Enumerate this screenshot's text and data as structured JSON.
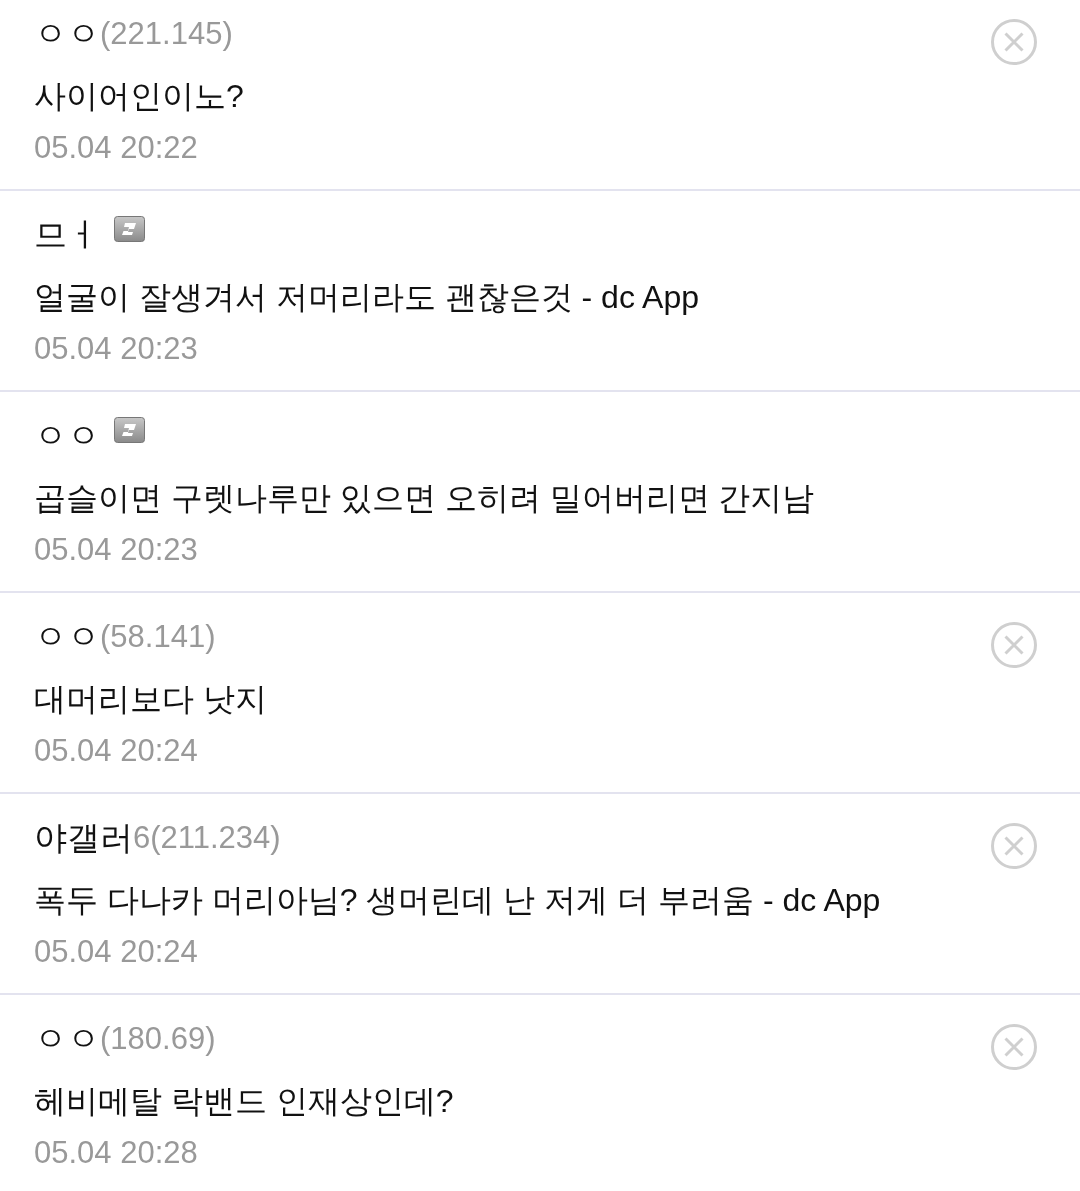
{
  "comments": [
    {
      "kind": "guest",
      "nickname": "ㅇㅇ",
      "ip": "(221.145)",
      "text": "사이어인이노?",
      "date": "05.04 20:22"
    },
    {
      "kind": "member",
      "nickname": "므ㅓ",
      "text": "얼굴이 잘생겨서 저머리라도 괜찮은것 - dc App",
      "date": "05.04 20:23"
    },
    {
      "kind": "member",
      "nickname": "ㅇㅇ",
      "text": "곱슬이면 구렛나루만 있으면 오히려 밀어버리면 간지남",
      "date": "05.04 20:23"
    },
    {
      "kind": "guest",
      "nickname": "ㅇㅇ",
      "ip": "(58.141)",
      "text": "대머리보다 낫지",
      "date": "05.04 20:24"
    },
    {
      "kind": "guest",
      "nickname": "야갤러",
      "ip": "6(211.234)",
      "text": "폭두 다나카 머리아님? 생머린데 난 저게 더 부러움 - dc App",
      "date": "05.04 20:24"
    },
    {
      "kind": "guest",
      "nickname": "ㅇㅇ",
      "ip": "(180.69)",
      "text": "헤비메탈 락밴드 인재상인데?",
      "date": "05.04 20:28"
    }
  ]
}
